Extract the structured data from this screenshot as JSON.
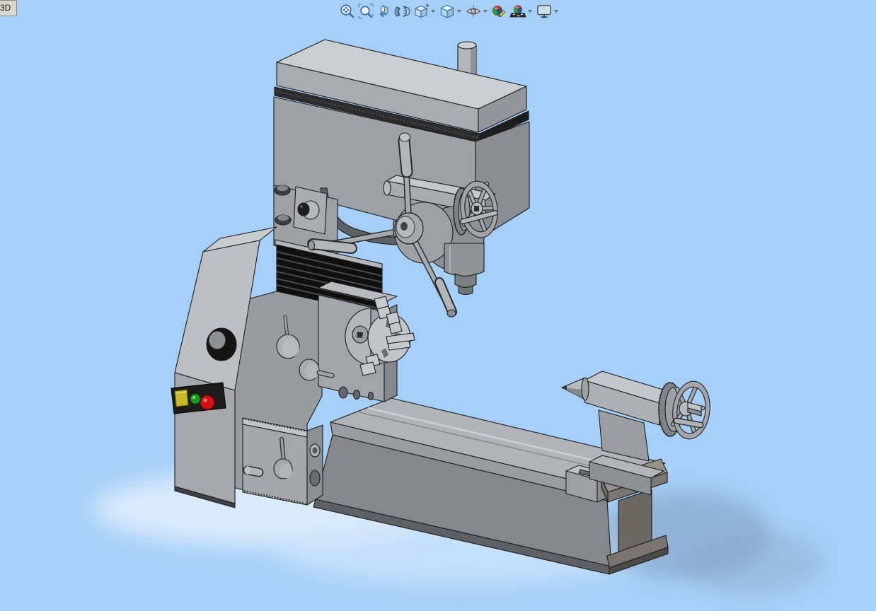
{
  "window": {
    "background_color": "#a5cff8"
  },
  "corner_tab": {
    "label": "3D"
  },
  "toolbar": {
    "buttons": [
      {
        "name": "zoom-to-fit-icon",
        "has_dropdown": false
      },
      {
        "name": "zoom-to-area-icon",
        "has_dropdown": false
      },
      {
        "name": "previous-view-icon",
        "has_dropdown": false
      },
      {
        "name": "section-view-icon",
        "has_dropdown": false
      },
      {
        "name": "view-orientation-icon",
        "has_dropdown": true
      },
      {
        "name": "display-style-icon",
        "has_dropdown": true
      },
      {
        "name": "hide-show-items-icon",
        "has_dropdown": true
      },
      {
        "name": "edit-appearance-icon",
        "has_dropdown": false
      },
      {
        "name": "apply-scene-icon",
        "has_dropdown": true
      },
      {
        "name": "view-settings-icon",
        "has_dropdown": true
      }
    ]
  },
  "viewport": {
    "description": "3D shaded CAD model of a combination lathe and milling machine on a light blue background",
    "model_main_color": "#9da1a4",
    "model_light_color": "#cbced0",
    "model_dark_color": "#85888b",
    "pedestal_color": "#787571",
    "outline_color": "#1c1c1c",
    "parts": [
      "motor cover",
      "head cylinder",
      "mill head body",
      "quill feed lever",
      "quill handwheel",
      "drill chuck quill",
      "column",
      "bellows",
      "machine base",
      "headstock",
      "three-jaw chuck",
      "headstock knobs",
      "cabinet",
      "power panel",
      "apron",
      "lathe bed",
      "bed clamp boss",
      "pedestal foot",
      "tailstock",
      "tailstock handwheel",
      "floor shadow"
    ],
    "power_panel": {
      "panel_color": "#1c1c1c",
      "buttons": [
        {
          "shape": "square",
          "color": "#c9b92a"
        },
        {
          "shape": "round",
          "color": "#17a017"
        },
        {
          "shape": "round",
          "color": "#d01212"
        }
      ]
    }
  }
}
